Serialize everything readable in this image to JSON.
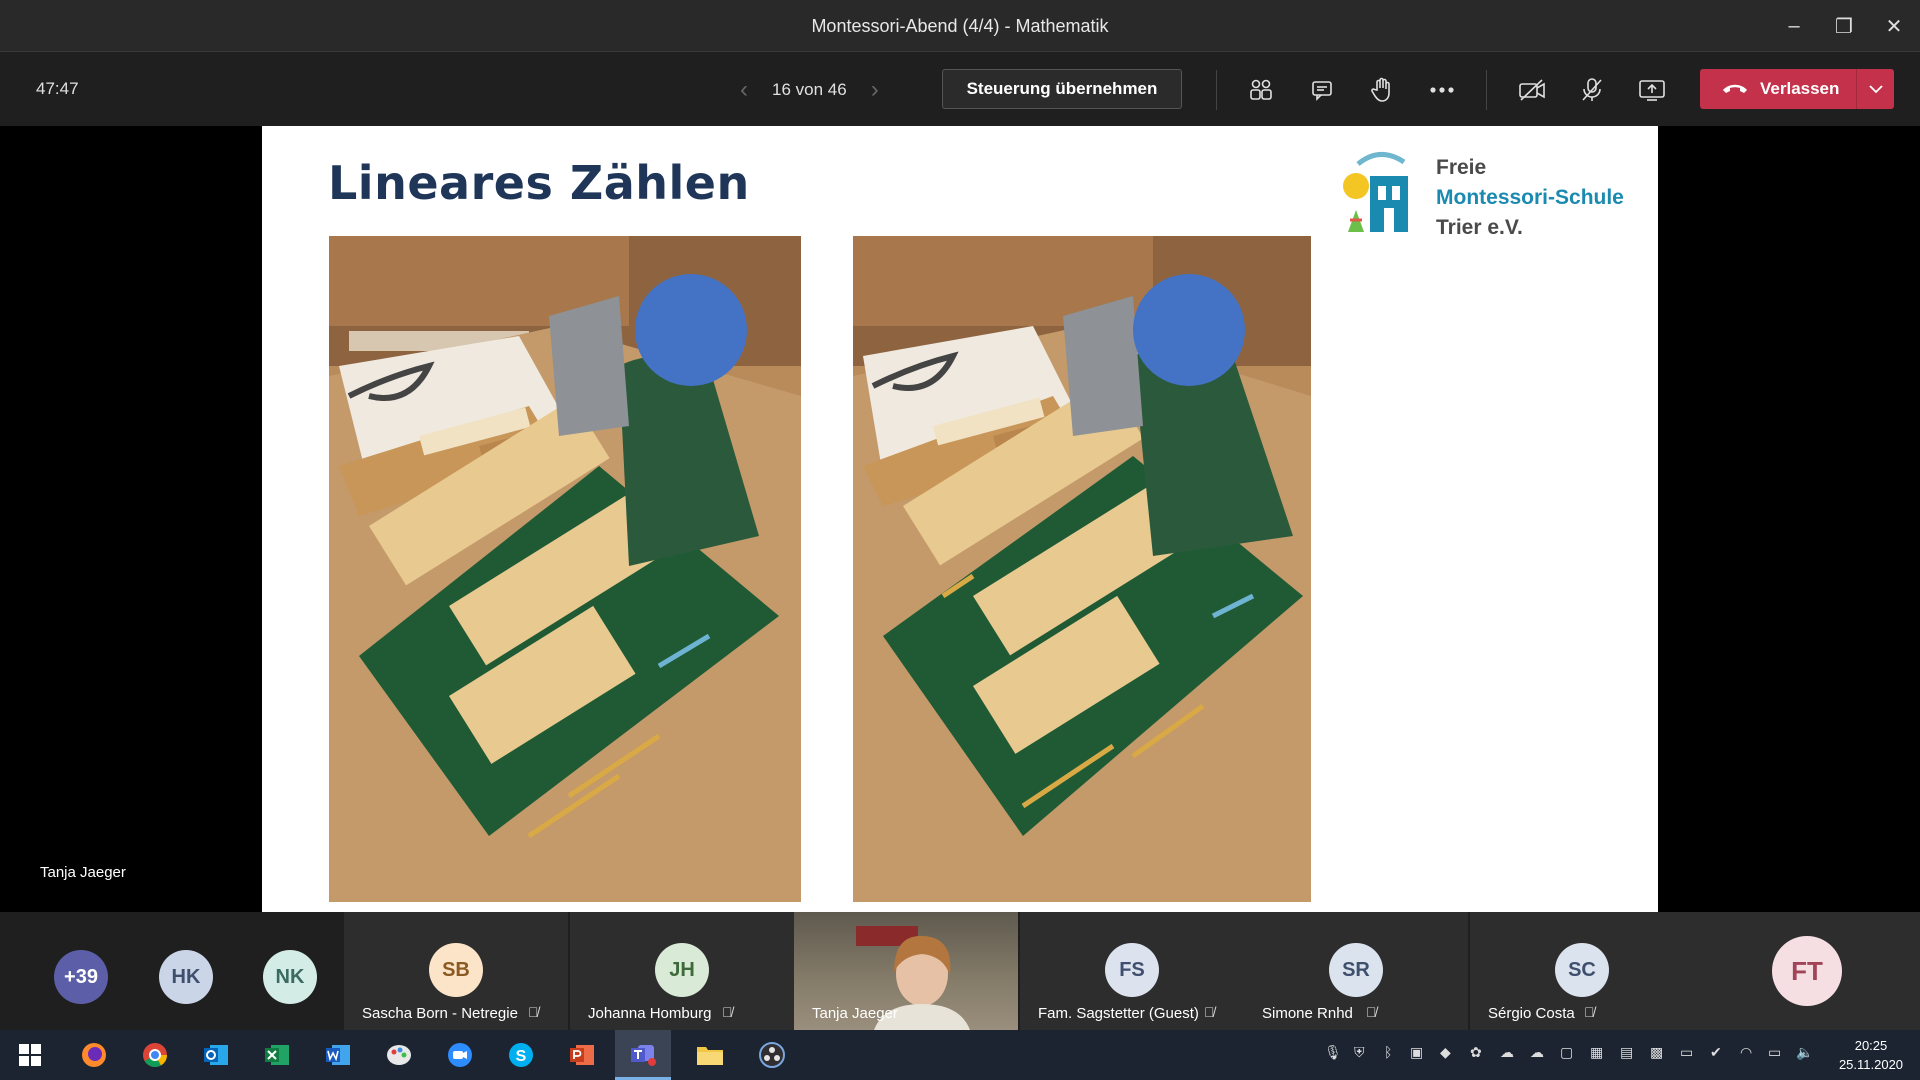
{
  "window": {
    "title": "Montessori-Abend (4/4) - Mathematik",
    "minimize": "–",
    "restore": "❐",
    "close": "✕"
  },
  "toolbar": {
    "timer": "47:47",
    "prev": "‹",
    "page": "16 von 46",
    "next": "›",
    "take_control": "Steuerung übernehmen",
    "icons": [
      "participants-icon",
      "chat-icon",
      "raise-hand-icon",
      "more-icon",
      "camera-off-icon",
      "mic-off-icon",
      "share-icon"
    ],
    "leave_label": "Verlassen",
    "leave_dropdown": "⌄"
  },
  "slide": {
    "title": "Lineares Zählen",
    "logo_line1": "Freie",
    "logo_line2": "Montessori-Schule",
    "logo_line3": "Trier e.V."
  },
  "presenter": {
    "name": "Tanja Jaeger"
  },
  "participants": {
    "overflow": "+39",
    "small": [
      {
        "initials": "HK",
        "bg": "#cad5e8",
        "fg": "#3f4f6e"
      },
      {
        "initials": "NK",
        "bg": "#d4ece6",
        "fg": "#3b6a5f"
      }
    ],
    "tiles": [
      {
        "initials": "SB",
        "name": "Sascha Born - Netregie",
        "bg": "#fbe4c8",
        "fg": "#8a5a22"
      },
      {
        "initials": "JH",
        "name": "Johanna Homburg",
        "bg": "#d9ead7",
        "fg": "#3e6a3b"
      },
      {
        "initials": "",
        "name": "Tanja Jaeger",
        "bg": "",
        "fg": ""
      },
      {
        "initials": "FS",
        "name": "Fam. Sagstetter (Guest)",
        "bg": "#dde3ee",
        "fg": "#3f4f6e"
      },
      {
        "initials": "SR",
        "name": "Simone Rnhd",
        "bg": "#dbe3ee",
        "fg": "#3f4f6e"
      },
      {
        "initials": "SC",
        "name": "Sérgio Costa",
        "bg": "#dbe3ee",
        "fg": "#3f4f6e"
      }
    ],
    "self": {
      "initials": "FT",
      "bg": "#f6dfe3",
      "fg": "#a04458"
    }
  },
  "taskbar": {
    "apps": [
      "windows-start",
      "firefox",
      "chrome",
      "outlook",
      "excel",
      "word",
      "paint",
      "zoom",
      "skype",
      "powerpoint",
      "teams",
      "explorer",
      "obs"
    ],
    "time": "20:25",
    "date": "25.11.2020"
  }
}
